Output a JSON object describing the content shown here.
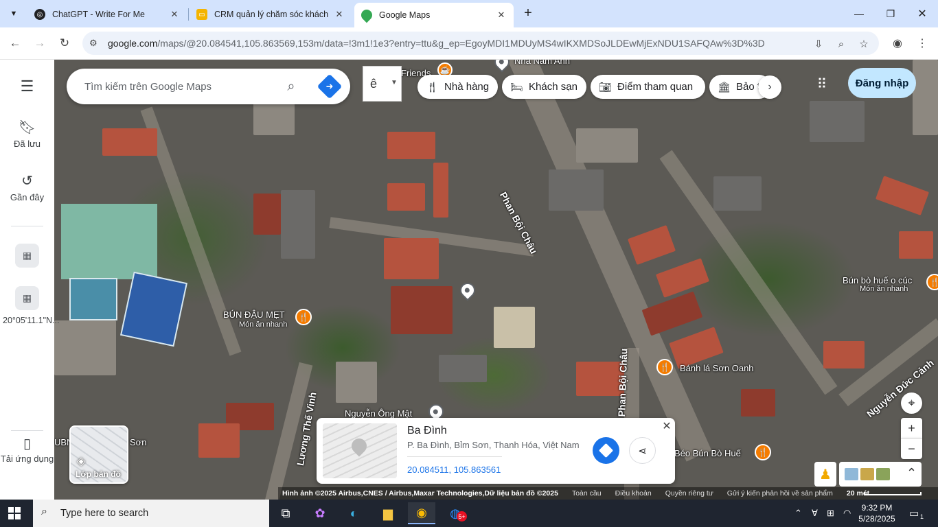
{
  "browser": {
    "tabs": [
      {
        "title": "ChatGPT - Write For Me",
        "favicon": "chatgpt-icon",
        "active": false
      },
      {
        "title": "CRM quản lý chăm sóc khách h",
        "favicon": "folder-icon",
        "active": false
      },
      {
        "title": "Google Maps",
        "favicon": "google-maps-icon",
        "active": true
      }
    ],
    "url_host": "google.com",
    "url_path": "/maps/@20.084541,105.863569,153m/data=!3m1!1e3?entry=ttu&g_ep=EgoyMDI1MDUyMS4wIKXMDSoJLDEwMjExNDU1SAFQAw%3D%3D"
  },
  "rail": {
    "saved_label": "Đã lưu",
    "recent_label": "Gần đây",
    "recent_place_label": "20°05'11.1\"N...",
    "get_app_label": "Tải ứng dụng"
  },
  "search": {
    "placeholder": "Tìm kiếm trên Google Maps"
  },
  "ime": {
    "key": "ê"
  },
  "chips": [
    {
      "label": "Nhà hàng",
      "icon": "restaurant-icon"
    },
    {
      "label": "Khách sạn",
      "icon": "hotel-icon"
    },
    {
      "label": "Điểm tham quan",
      "icon": "camera-icon"
    },
    {
      "label": "Bảo tàng",
      "icon": "museum-icon"
    }
  ],
  "signin_label": "Đăng nhập",
  "map": {
    "labels": {
      "nha_nam_anh": "Nhà Nam Anh",
      "friends": "Friends",
      "phan_boi_chau_1": "Phan Bội Châu",
      "phan_boi_chau_2": "Phan Bội Châu",
      "bun_dau": "BÚN ĐẬU MẸT",
      "bun_dau_sub": "Món ăn nhanh",
      "bun_bo_cuc": "Bún bò huế o cúc",
      "bun_bo_cuc_sub": "Món ăn nhanh",
      "banh_la": "Bánh lá Sơn Oanh",
      "luong_the_vinh": "Lương Thế Vinh",
      "nguyen_ong_mat": "Nguyễn Ông Mật",
      "nguyen_duc_canh": "Nguyễn Đức Cảnh",
      "beo_bun": "Béo Bún Bò Huế",
      "ubnd": "UBN",
      "son": "Sơn"
    },
    "layers_label": "Lớp bản đồ"
  },
  "card": {
    "title": "Ba Đình",
    "address": "P. Ba Đình, Bỉm Sơn, Thanh Hóa, Việt Nam",
    "coords": "20.084511, 105.863561"
  },
  "attribution": {
    "imagery": "Hình ảnh ©2025 Airbus,CNES / Airbus,Maxar Technologies,Dữ liệu bản đồ ©2025",
    "global": "Toàn cầu",
    "terms": "Điều khoản",
    "privacy": "Quyền riêng tư",
    "feedback": "Gửi ý kiến phản hồi về sản phẩm",
    "scale": "20 mét"
  },
  "taskbar": {
    "search_placeholder": "Type here to search",
    "time": "9:32 PM",
    "date": "5/28/2025",
    "notif_count": "1",
    "badge_count": "5+"
  },
  "colors": {
    "maps_blue": "#1a73e8",
    "poi_orange": "#f57c00",
    "signin_bg": "#c2e7ff",
    "tabstrip": "#d3e3fd"
  }
}
